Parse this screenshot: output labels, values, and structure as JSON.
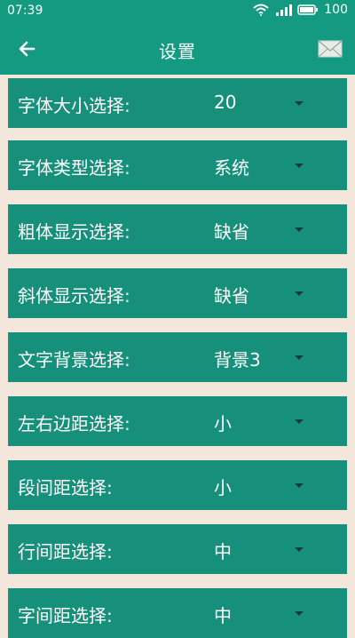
{
  "status_bar": {
    "time": "07:39",
    "battery": "100",
    "icons": [
      "wifi-icon",
      "signal-icon",
      "battery-icon"
    ]
  },
  "app_bar": {
    "title": "设置",
    "left_icon": "back-arrow-icon",
    "right_icon": "mail-icon"
  },
  "colors": {
    "primary": "#159a82",
    "row_bg": "#168f7b",
    "page_bg": "#f3e6da",
    "arrow": "#1c3a35"
  },
  "settings": [
    {
      "label": "字体大小选择:",
      "value": "20"
    },
    {
      "label": "字体类型选择:",
      "value": "系统"
    },
    {
      "label": "粗体显示选择:",
      "value": "缺省"
    },
    {
      "label": "斜体显示选择:",
      "value": "缺省"
    },
    {
      "label": "文字背景选择:",
      "value": "背景3"
    },
    {
      "label": "左右边距选择:",
      "value": "小"
    },
    {
      "label": "段间距选择:",
      "value": "小"
    },
    {
      "label": "行间距选择:",
      "value": "中"
    },
    {
      "label": "字间距选择:",
      "value": "中"
    }
  ]
}
